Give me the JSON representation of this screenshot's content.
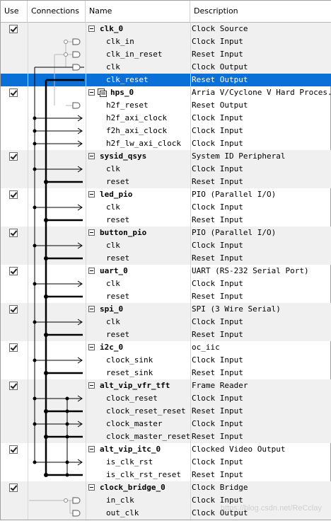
{
  "header": {
    "use": "Use",
    "connections": "Connections",
    "name": "Name",
    "description": "Description"
  },
  "rows": [
    {
      "type": "component",
      "name": "clk_0",
      "desc": "Clock Source"
    },
    {
      "type": "port",
      "name": "clk_in",
      "desc": "Clock Input"
    },
    {
      "type": "port",
      "name": "clk_in_reset",
      "desc": "Reset Input"
    },
    {
      "type": "port",
      "name": "clk",
      "desc": "Clock Output"
    },
    {
      "type": "port",
      "name": "clk_reset",
      "desc": "Reset Output",
      "selected": true
    },
    {
      "type": "component",
      "name": "hps_0",
      "desc": "Arria V/Cyclone V Hard Proces...",
      "icon": true
    },
    {
      "type": "port",
      "name": "h2f_reset",
      "desc": "Reset Output"
    },
    {
      "type": "port",
      "name": "h2f_axi_clock",
      "desc": "Clock Input"
    },
    {
      "type": "port",
      "name": "f2h_axi_clock",
      "desc": "Clock Input"
    },
    {
      "type": "port",
      "name": "h2f_lw_axi_clock",
      "desc": "Clock Input"
    },
    {
      "type": "component",
      "name": "sysid_qsys",
      "desc": "System ID Peripheral"
    },
    {
      "type": "port",
      "name": "clk",
      "desc": "Clock Input"
    },
    {
      "type": "port",
      "name": "reset",
      "desc": "Reset Input"
    },
    {
      "type": "component",
      "name": "led_pio",
      "desc": "PIO (Parallel I/O)"
    },
    {
      "type": "port",
      "name": "clk",
      "desc": "Clock Input"
    },
    {
      "type": "port",
      "name": "reset",
      "desc": "Reset Input"
    },
    {
      "type": "component",
      "name": "button_pio",
      "desc": "PIO (Parallel I/O)"
    },
    {
      "type": "port",
      "name": "clk",
      "desc": "Clock Input"
    },
    {
      "type": "port",
      "name": "reset",
      "desc": "Reset Input"
    },
    {
      "type": "component",
      "name": "uart_0",
      "desc": "UART (RS-232 Serial Port)"
    },
    {
      "type": "port",
      "name": "clk",
      "desc": "Clock Input"
    },
    {
      "type": "port",
      "name": "reset",
      "desc": "Reset Input"
    },
    {
      "type": "component",
      "name": "spi_0",
      "desc": "SPI (3 Wire Serial)"
    },
    {
      "type": "port",
      "name": "clk",
      "desc": "Clock Input"
    },
    {
      "type": "port",
      "name": "reset",
      "desc": "Reset Input"
    },
    {
      "type": "component",
      "name": "i2c_0",
      "desc": "oc_iic"
    },
    {
      "type": "port",
      "name": "clock_sink",
      "desc": "Clock Input"
    },
    {
      "type": "port",
      "name": "reset_sink",
      "desc": "Reset Input"
    },
    {
      "type": "component",
      "name": "alt_vip_vfr_tft",
      "desc": "Frame Reader"
    },
    {
      "type": "port",
      "name": "clock_reset",
      "desc": "Clock Input"
    },
    {
      "type": "port",
      "name": "clock_reset_reset",
      "desc": "Reset Input"
    },
    {
      "type": "port",
      "name": "clock_master",
      "desc": "Clock Input"
    },
    {
      "type": "port",
      "name": "clock_master_reset",
      "desc": "Reset Input"
    },
    {
      "type": "component",
      "name": "alt_vip_itc_0",
      "desc": "Clocked Video Output"
    },
    {
      "type": "port",
      "name": "is_clk_rst",
      "desc": "Clock Input"
    },
    {
      "type": "port",
      "name": "is_clk_rst_reset",
      "desc": "Reset Input"
    },
    {
      "type": "component",
      "name": "clock_bridge_0",
      "desc": "Clock Bridge"
    },
    {
      "type": "port",
      "name": "in_clk",
      "desc": "Clock Input"
    },
    {
      "type": "port",
      "name": "out_clk",
      "desc": "Clock Output"
    }
  ],
  "watermark": "https://blog.csdn.net/ReCclay",
  "colors": {
    "selected": "#0a6fd6",
    "alt_row": "#f0f0f0"
  }
}
